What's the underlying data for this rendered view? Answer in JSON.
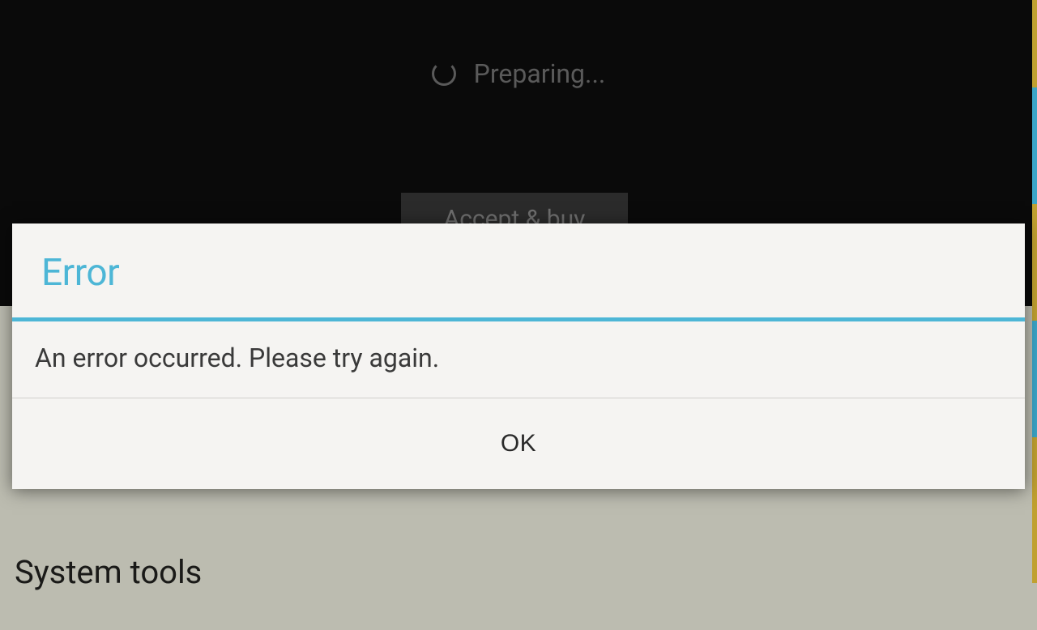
{
  "background": {
    "preparing_label": "Preparing...",
    "accept_button_label": "Accept & buy",
    "bottom_label": "System tools"
  },
  "dialog": {
    "title": "Error",
    "message": "An error occurred. Please try again.",
    "ok_label": "OK"
  },
  "colors": {
    "accent": "#4db6d6",
    "dialog_bg": "#f5f4f2",
    "text_dark": "#3a3a3a"
  }
}
